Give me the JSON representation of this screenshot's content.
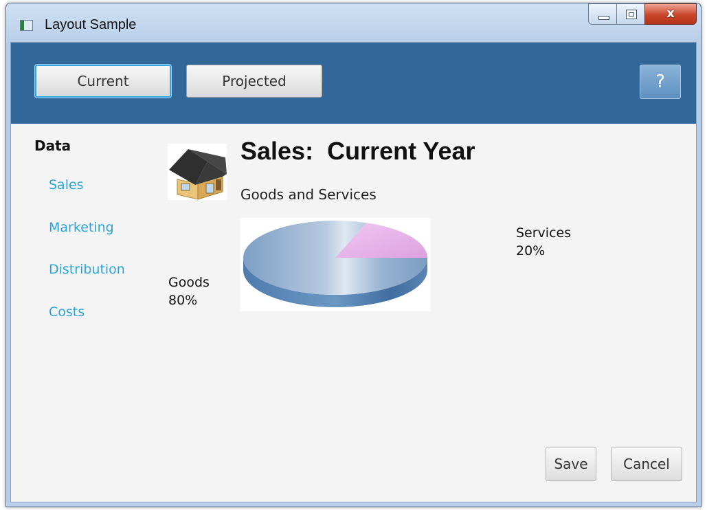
{
  "window": {
    "title": "Layout Sample",
    "close_glyph": "x"
  },
  "toolbar": {
    "current_label": "Current",
    "projected_label": "Projected",
    "help_label": "?"
  },
  "sidebar": {
    "title": "Data",
    "items": [
      {
        "label": "Sales"
      },
      {
        "label": "Marketing"
      },
      {
        "label": "Distribution"
      },
      {
        "label": "Costs"
      }
    ]
  },
  "content": {
    "heading": "Sales:  Current Year",
    "subheading": "Goods and Services"
  },
  "chart_data": {
    "type": "pie",
    "title": "",
    "slices": [
      {
        "name": "Goods",
        "value": 80,
        "label": "80%",
        "color": "#9bb7d4"
      },
      {
        "name": "Services",
        "value": 20,
        "label": "20%",
        "color": "#e8b3e8"
      }
    ]
  },
  "footer": {
    "save_label": "Save",
    "cancel_label": "Cancel"
  },
  "colors": {
    "header_band": "#336699",
    "link": "#2aa5d9",
    "focus_ring": "#3aa7e0"
  }
}
